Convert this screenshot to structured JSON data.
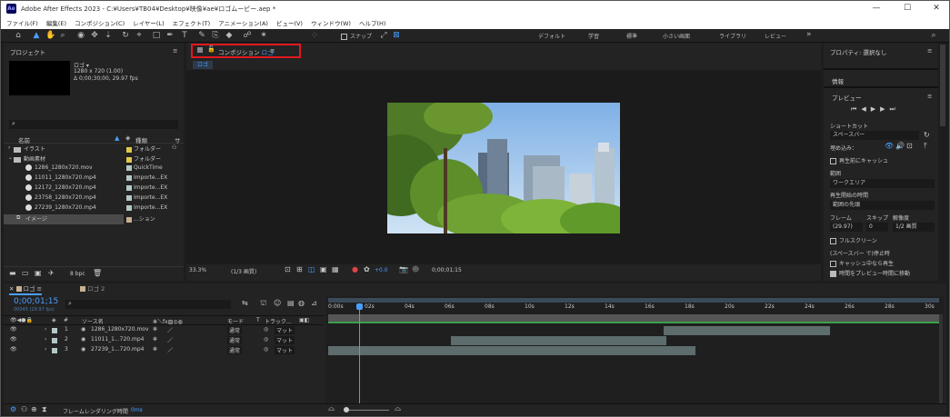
{
  "window": {
    "app_icon": "Ae",
    "title": "Adobe After Effects 2023 - C:¥Users¥TB04¥Desktop¥映像¥ae¥ロゴムービー.aep *",
    "controls": [
      "—",
      "☐",
      "✕"
    ]
  },
  "menu": [
    "ファイル(F)",
    "編集(E)",
    "コンポジション(C)",
    "レイヤー(L)",
    "エフェクト(T)",
    "アニメーション(A)",
    "ビュー(V)",
    "ウィンドウ(W)",
    "ヘルプ(H)"
  ],
  "toolbar": {
    "snap_label": "スナップ",
    "workspaces": [
      "デフォルト",
      "学習",
      "標準",
      "小さい画面",
      "ライブラリ",
      "レビュー"
    ],
    "more": "»"
  },
  "project": {
    "title": "プロジェクト",
    "menu_icon": "≡",
    "item_name": "ロゴ ▾",
    "item_info1": "1280 x 720 (1.00)",
    "item_info2": "Δ 0;00;30;00, 29.97 fps",
    "search_placeholder": "",
    "col_name": "名前",
    "col_type": "種類",
    "col_size": "サ",
    "items": [
      {
        "name": "イラスト",
        "type": "フォルダー",
        "kind": "folder",
        "color": "#e0c84a"
      },
      {
        "name": "動画素材",
        "type": "フォルダー",
        "kind": "folder",
        "color": "#e0c84a"
      },
      {
        "name": "1286_1280x720.mov",
        "type": "QuickTime",
        "kind": "file",
        "color": "#b5c8c8"
      },
      {
        "name": "11011_1280x720.mp4",
        "type": "Importe...EX",
        "kind": "file",
        "color": "#b5c8c8"
      },
      {
        "name": "12172_1280x720.mp4",
        "type": "Importe...EX",
        "kind": "file",
        "color": "#b5c8c8"
      },
      {
        "name": "23758_1280x720.mp4",
        "type": "Importe...EX",
        "kind": "file",
        "color": "#b5c8c8"
      },
      {
        "name": "27239_1280x720.mp4",
        "type": "Importe...EX",
        "kind": "file",
        "color": "#b5c8c8"
      },
      {
        "name": "イメージ",
        "type": "...ション",
        "kind": "comp",
        "color": "#c8b090"
      }
    ],
    "bpc": "8 bpc"
  },
  "composition": {
    "tab_label": "コンポジション",
    "tab_name": "ロゴ",
    "menu_icon": "≡",
    "sub_tab": "ロゴ",
    "zoom": "33.3%",
    "resolution": "(1/3 画質)",
    "exposure": "+0.0",
    "timecode": "0;00;01;15"
  },
  "right_panel": {
    "properties": "プロパティ: 選択なし",
    "info": "情報",
    "preview": "プレビュー",
    "shortcut_label": "ショートカット",
    "shortcut_value": "スペースバー",
    "include_label": "埋め込み：",
    "cache_before": "再生前にキャッシュ",
    "range_label": "範囲",
    "range_value": "ワークエリア",
    "playfrom_label": "再生開始の時間",
    "playfrom_value": "範囲の先頭",
    "frame_label": "フレーム",
    "skip_label": "スキップ",
    "res_label": "解像度",
    "frame_value": "(29.97)",
    "skip_value": "0",
    "res_value": "1/2 画質",
    "fullscreen": "フルスクリーン",
    "stop_label": "(スペースバー で)停止時",
    "cache_play": "キャッシュ中なら再生",
    "move_time": "時間をプレビュー時間に移動"
  },
  "timeline": {
    "tabs": [
      "ロゴ",
      "ロゴ 2"
    ],
    "timecode": "0;00;01;15",
    "frame_info": "00045 (29.97 fps)",
    "col_source": "ソース名",
    "col_mode": "モード",
    "col_t": "T",
    "col_track": "トラック...",
    "layers": [
      {
        "num": "1",
        "name": "1286_1280x720.mov",
        "mode": "通常",
        "track": "マット"
      },
      {
        "num": "2",
        "name": "11011_1...720.mp4",
        "mode": "通常",
        "track": "マット"
      },
      {
        "num": "3",
        "name": "27239_1...720.mp4",
        "mode": "通常",
        "track": "マット"
      }
    ],
    "ticks": [
      "0:00s",
      "02s",
      "04s",
      "06s",
      "08s",
      "10s",
      "12s",
      "14s",
      "16s",
      "18s",
      "20s",
      "22s",
      "24s",
      "26s",
      "28s",
      "30s"
    ],
    "render_label": "フレームレンダリング時間",
    "render_value": "0ms"
  }
}
